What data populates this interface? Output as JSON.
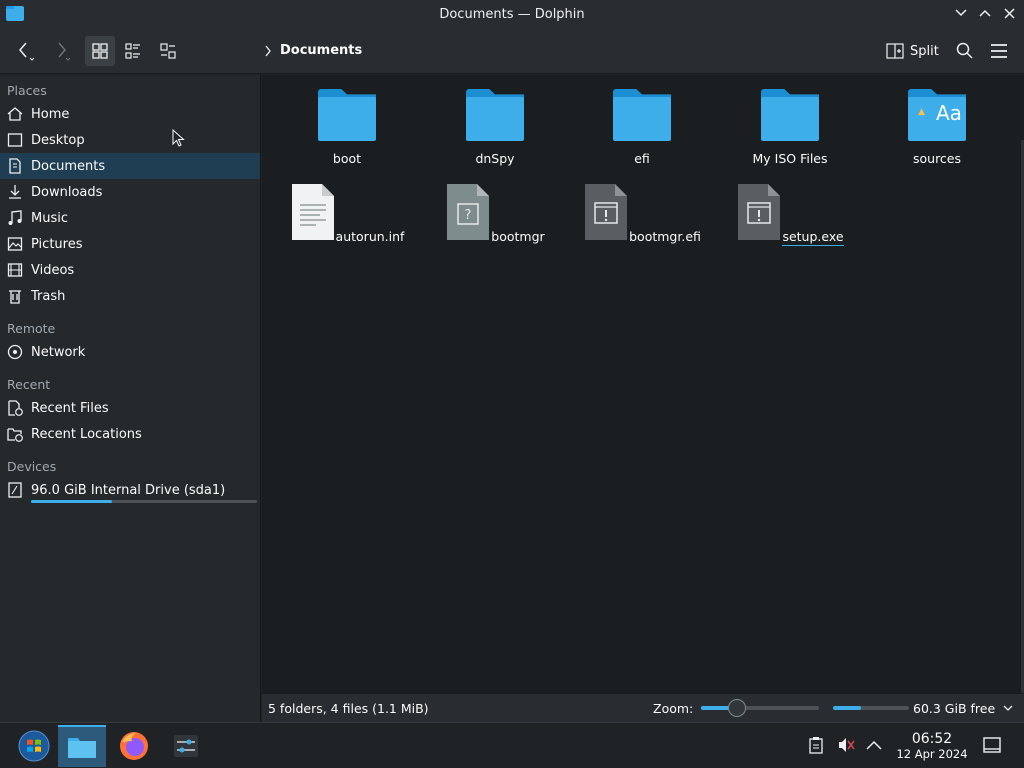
{
  "window": {
    "title": "Documents — Dolphin"
  },
  "toolbar": {
    "breadcrumb": "Documents",
    "split_label": "Split"
  },
  "sidebar": {
    "sections": [
      {
        "title": "Places",
        "items": [
          "Home",
          "Desktop",
          "Documents",
          "Downloads",
          "Music",
          "Pictures",
          "Videos",
          "Trash"
        ]
      },
      {
        "title": "Remote",
        "items": [
          "Network"
        ]
      },
      {
        "title": "Recent",
        "items": [
          "Recent Files",
          "Recent Locations"
        ]
      },
      {
        "title": "Devices",
        "items": [
          "96.0 GiB Internal Drive (sda1)"
        ]
      }
    ],
    "selected": "Documents",
    "drive_usage_fraction": 0.36
  },
  "files": [
    {
      "name": "boot",
      "type": "folder"
    },
    {
      "name": "dnSpy",
      "type": "folder"
    },
    {
      "name": "efi",
      "type": "folder"
    },
    {
      "name": "My ISO Files",
      "type": "folder"
    },
    {
      "name": "sources",
      "type": "folder-fonts"
    },
    {
      "name": "autorun.inf",
      "type": "text-file"
    },
    {
      "name": "bootmgr",
      "type": "unknown-file"
    },
    {
      "name": "bootmgr.efi",
      "type": "executable-file"
    },
    {
      "name": "setup.exe",
      "type": "executable-file"
    }
  ],
  "status": {
    "summary": "5 folders, 4 files (1.1 MiB)",
    "zoom_label": "Zoom:",
    "zoom_fraction": 0.3,
    "free_label": "60.3 GiB free",
    "free_used_fraction": 0.37
  },
  "taskbar": {
    "time": "06:52",
    "date": "12 Apr 2024"
  },
  "colors": {
    "accent": "#3daee9",
    "selection": "#1f3e53",
    "background": "#1b1e20"
  }
}
